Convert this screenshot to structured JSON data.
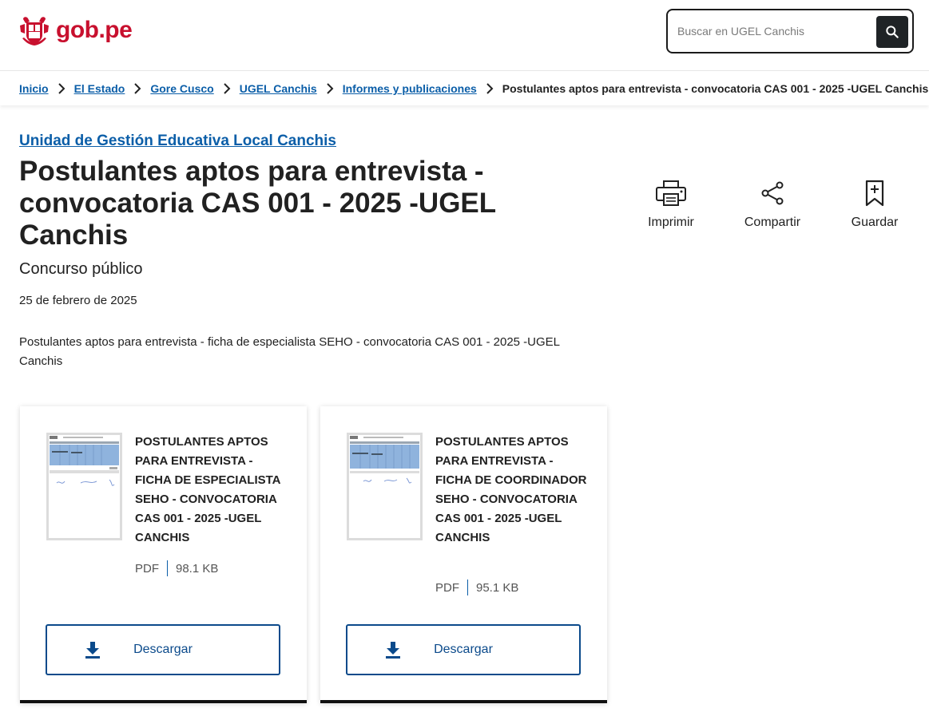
{
  "brand": {
    "logo_text": "gob.pe",
    "accent": "#c8102e",
    "link_color": "#0b5ea8"
  },
  "search": {
    "placeholder": "Buscar en UGEL Canchis",
    "icon": "search-icon"
  },
  "breadcrumb": {
    "links": [
      "Inicio",
      "El Estado",
      "Gore Cusco",
      "UGEL Canchis",
      "Informes y publicaciones"
    ],
    "current": "Postulantes aptos para entrevista - convocatoria CAS 001 - 2025 -UGEL Canchis"
  },
  "main": {
    "org_link": "Unidad de Gestión Educativa Local Canchis",
    "title": "Postulantes aptos para entrevista - convocatoria CAS 001 - 2025 -UGEL Canchis",
    "subtitle": "Concurso público",
    "date": "25 de febrero de 2025",
    "description": "Postulantes aptos para entrevista - ficha de especialista SEHO - convocatoria CAS 001 - 2025 -UGEL Canchis"
  },
  "actions": [
    {
      "label": "Imprimir",
      "icon": "printer-icon"
    },
    {
      "label": "Compartir",
      "icon": "share-icon"
    },
    {
      "label": "Guardar",
      "icon": "bookmark-add-icon"
    }
  ],
  "documents": [
    {
      "title": "POSTULANTES APTOS PARA ENTREVISTA - FICHA DE ESPECIALISTA SEHO - CONVOCATORIA CAS 001 - 2025 -UGEL CANCHIS",
      "format": "PDF",
      "size": "98.1 KB",
      "button": "Descargar"
    },
    {
      "title": "POSTULANTES APTOS PARA ENTREVISTA - FICHA DE COORDINADOR SEHO - CONVOCATORIA CAS 001 - 2025 -UGEL CANCHIS",
      "format": "PDF",
      "size": "95.1 KB",
      "button": "Descargar"
    }
  ]
}
